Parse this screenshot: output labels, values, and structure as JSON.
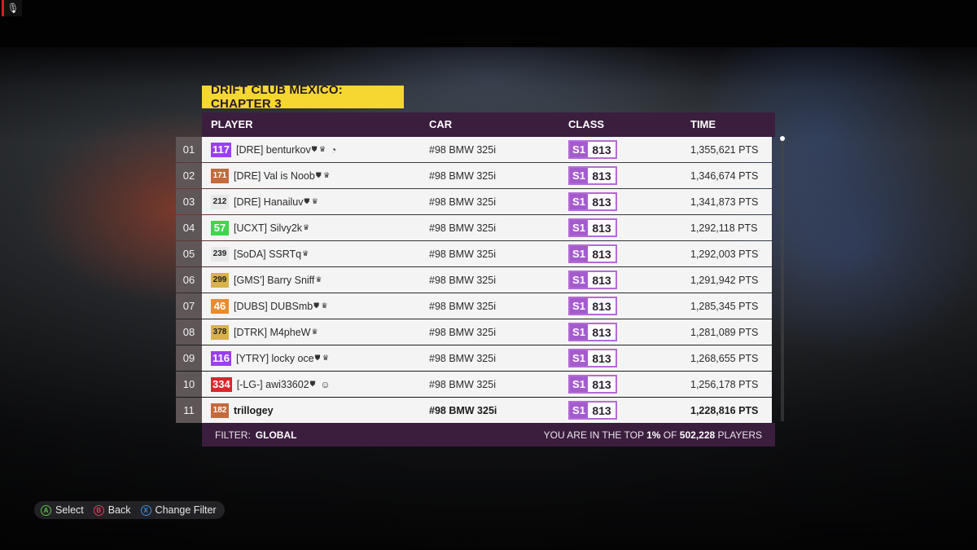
{
  "event": {
    "title": "DRIFT CLUB MEXICO: CHAPTER 3"
  },
  "columns": {
    "player": "PLAYER",
    "car": "CAR",
    "class": "CLASS",
    "time": "TIME"
  },
  "rows": [
    {
      "rank": "01",
      "level": "117",
      "level_bg": "#9b3ff2",
      "level_fg": "#ffffff",
      "player": "[DRE] benturkov",
      "badges": "⛊ ♛",
      "extra": "◔",
      "car": "#98 BMW 325i",
      "class": "S1",
      "pi": "813",
      "time": "1,355,621 PTS"
    },
    {
      "rank": "02",
      "level": "171",
      "level_bg": "#c46a3c",
      "level_fg": "#ffffff",
      "player": "[DRE] Val is Noob",
      "badges": "⛊ ♛",
      "extra": "",
      "car": "#98 BMW 325i",
      "class": "S1",
      "pi": "813",
      "time": "1,346,674 PTS"
    },
    {
      "rank": "03",
      "level": "212",
      "level_bg": "#e8e8e8",
      "level_fg": "#222222",
      "player": "[DRE] Hanailuv",
      "badges": "⛊ ♛",
      "extra": "",
      "car": "#98 BMW 325i",
      "class": "S1",
      "pi": "813",
      "time": "1,341,873 PTS"
    },
    {
      "rank": "04",
      "level": "57",
      "level_bg": "#3fd64a",
      "level_fg": "#ffffff",
      "player": "[UCXT] Silvy2k",
      "badges": "♛",
      "extra": "",
      "car": "#98 BMW 325i",
      "class": "S1",
      "pi": "813",
      "time": "1,292,118 PTS"
    },
    {
      "rank": "05",
      "level": "239",
      "level_bg": "#e8e8e8",
      "level_fg": "#222222",
      "player": "[SoDA] SSRTq",
      "badges": "♛",
      "extra": "",
      "car": "#98 BMW 325i",
      "class": "S1",
      "pi": "813",
      "time": "1,292,003 PTS"
    },
    {
      "rank": "06",
      "level": "299",
      "level_bg": "#d9b24a",
      "level_fg": "#222222",
      "player": "[GMS'] Barry Sniff",
      "badges": "♛",
      "extra": "",
      "car": "#98 BMW 325i",
      "class": "S1",
      "pi": "813",
      "time": "1,291,942 PTS"
    },
    {
      "rank": "07",
      "level": "46",
      "level_bg": "#ef8a2a",
      "level_fg": "#ffffff",
      "player": "[DUBS] DUBSmb",
      "badges": "⛊ ♛",
      "extra": "",
      "car": "#98 BMW 325i",
      "class": "S1",
      "pi": "813",
      "time": "1,285,345 PTS"
    },
    {
      "rank": "08",
      "level": "378",
      "level_bg": "#d9b24a",
      "level_fg": "#222222",
      "player": "[DTRK] M4pheW",
      "badges": "♛",
      "extra": "",
      "car": "#98 BMW 325i",
      "class": "S1",
      "pi": "813",
      "time": "1,281,089 PTS"
    },
    {
      "rank": "09",
      "level": "116",
      "level_bg": "#9b3ff2",
      "level_fg": "#ffffff",
      "player": "[YTRY] locky oce",
      "badges": "⛊ ♛",
      "extra": "",
      "car": "#98 BMW 325i",
      "class": "S1",
      "pi": "813",
      "time": "1,268,655 PTS"
    },
    {
      "rank": "10",
      "level": "334",
      "level_bg": "#d9262b",
      "level_fg": "#ffffff",
      "player": "[-LG-] awi33602",
      "badges": "⛊",
      "extra": "☺",
      "car": "#98 BMW 325i",
      "class": "S1",
      "pi": "813",
      "time": "1,256,178 PTS"
    },
    {
      "rank": "11",
      "level": "182",
      "level_bg": "#c46a3c",
      "level_fg": "#ffffff",
      "player": "trillogey",
      "badges": "",
      "extra": "",
      "car": "#98 BMW 325i",
      "class": "S1",
      "pi": "813",
      "time": "1,228,816 PTS",
      "is_current_user": true
    }
  ],
  "footer": {
    "filter_label": "FILTER:",
    "filter_value": "GLOBAL",
    "top_prefix": "YOU ARE IN THE TOP ",
    "top_percent": "1%",
    "top_mid": " OF ",
    "top_count": "502,228",
    "top_suffix": " PLAYERS"
  },
  "prompts": [
    {
      "glyph": "A",
      "color": "#5cc24a",
      "label": "Select"
    },
    {
      "glyph": "B",
      "color": "#e0405a",
      "label": "Back"
    },
    {
      "glyph": "X",
      "color": "#3c8ee8",
      "label": "Change Filter"
    }
  ],
  "colors": {
    "header_bg": "#3b1d3e",
    "title_bg": "#f6d631",
    "class_s1": "#a45ccc"
  }
}
